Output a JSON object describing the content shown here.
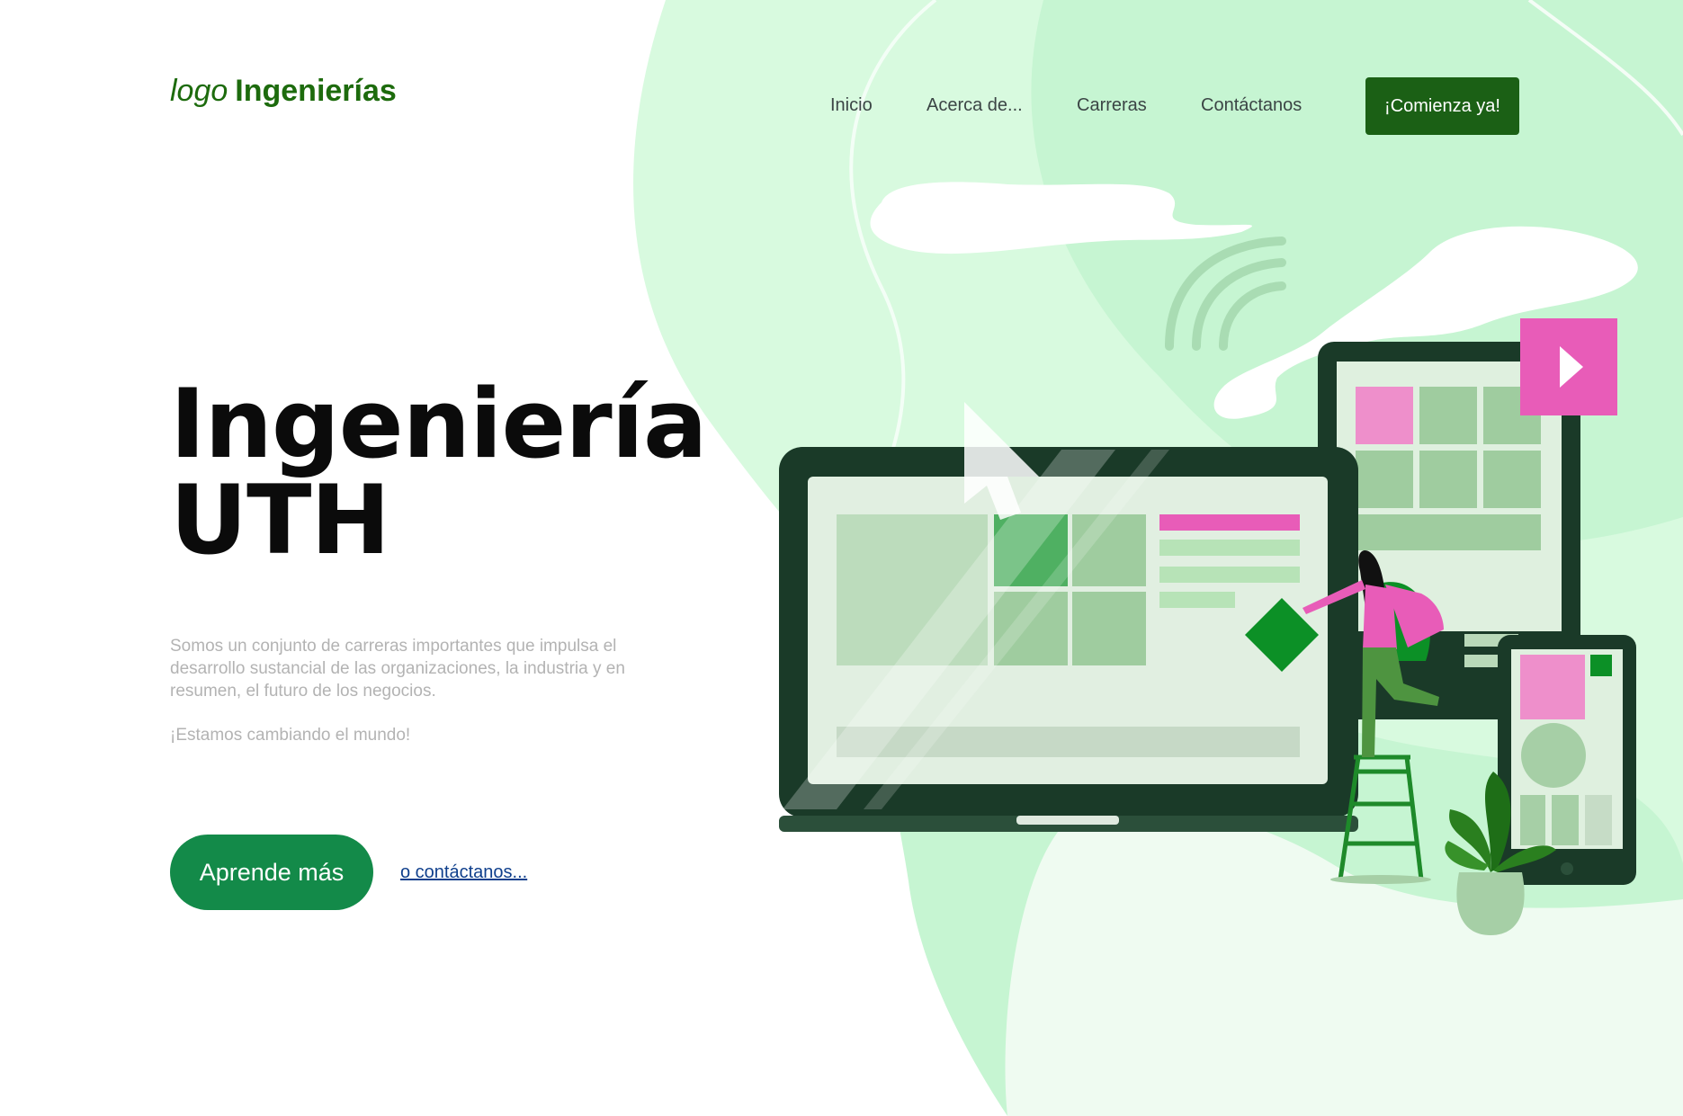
{
  "brand": {
    "logo_word": "logo",
    "name": "Ingenierías",
    "color": "#1d6b0d"
  },
  "nav": {
    "items": [
      {
        "label": "Inicio"
      },
      {
        "label": "Acerca de..."
      },
      {
        "label": "Carreras"
      },
      {
        "label": "Contáctanos"
      }
    ],
    "cta_label": "¡Comienza ya!",
    "cta_color": "#1b6015"
  },
  "hero": {
    "title_line1": "Ingeniería",
    "title_line2": "UTH",
    "description": "Somos un conjunto de carreras importantes que impulsa el desarrollo sustancial de las organizaciones, la industria y en resumen, el futuro de los negocios.",
    "tagline": "¡Estamos cambiando el mundo!",
    "primary_button": "Aprende más",
    "secondary_link": "o contáctanos..."
  },
  "theme": {
    "accent": "#138a49",
    "pink": "#e85cb8",
    "dark_green": "#1a3a28",
    "light_green": "#c6f5d2",
    "link_color": "#0f3f8c"
  },
  "illustration": {
    "icons": [
      "laptop-icon",
      "tablet-icon",
      "phone-icon",
      "cursor-arrow-icon",
      "wifi-signal-icon",
      "play-icon",
      "person-figure",
      "ladder-icon",
      "plant-icon"
    ]
  }
}
